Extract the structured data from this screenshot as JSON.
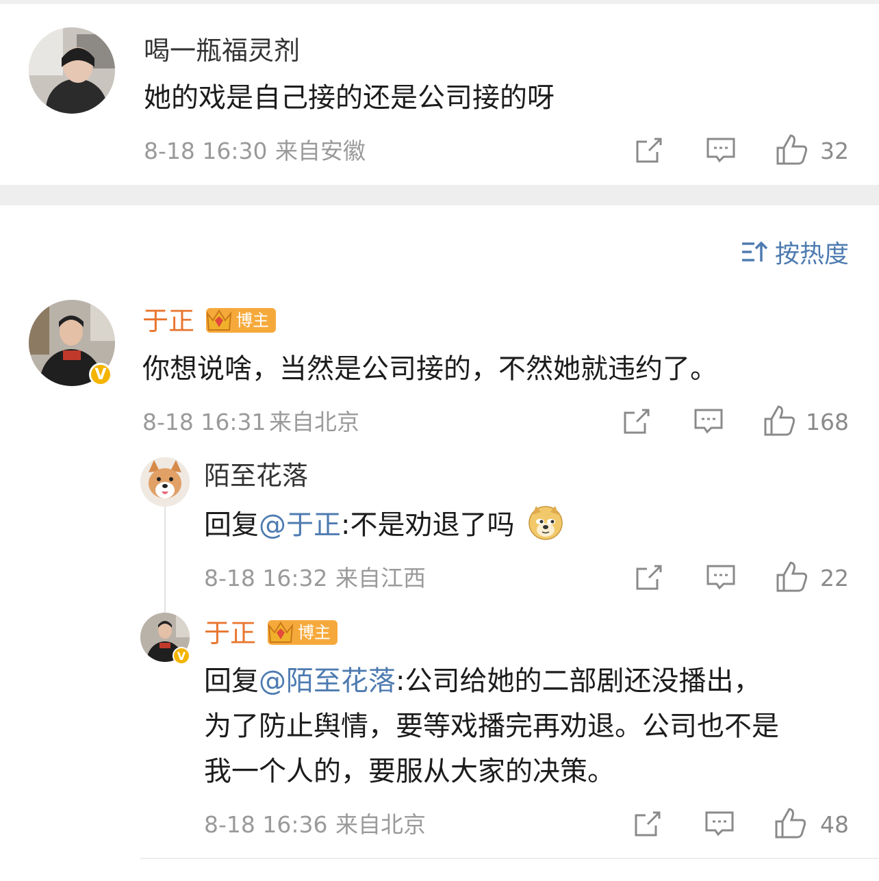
{
  "post_comment": {
    "username": "喝一瓶福灵剂",
    "text": "她的戏是自己接的还是公司接的呀",
    "time": "8-18 16:30",
    "location": "来自安徽",
    "likes": "32"
  },
  "sort": {
    "label": "按热度"
  },
  "comment": {
    "username": "于正",
    "badge": "博主",
    "text": "你想说啥，当然是公司接的，不然她就违约了。",
    "time": "8-18 16:31",
    "location": "来自北京",
    "likes": "168",
    "replies": [
      {
        "username": "陌至花落",
        "reply_prefix": "回复",
        "mention": "@于正",
        "text": ":不是劝退了吗",
        "time": "8-18 16:32",
        "location": "来自江西",
        "likes": "22"
      },
      {
        "username": "于正",
        "badge": "博主",
        "reply_prefix": "回复",
        "mention": "@陌至花落",
        "text_line1": ":公司给她的二部剧还没播出，",
        "text_line2": "为了防止舆情，要等戏播完再劝退。公司也不是",
        "text_line3": "我一个人的，要服从大家的决策。",
        "time": "8-18 16:36",
        "location": "来自北京",
        "likes": "48"
      }
    ]
  },
  "colors": {
    "accent_blue": "#4e7bb0",
    "blogger_orange": "#e8752f",
    "badge_gold": "#f6a93b",
    "meta_gray": "#9a9a9a"
  },
  "icons": [
    "share-icon",
    "comment-icon",
    "like-icon",
    "sort-icon",
    "crown-icon",
    "verified-v-icon",
    "doge-emoji-icon"
  ]
}
